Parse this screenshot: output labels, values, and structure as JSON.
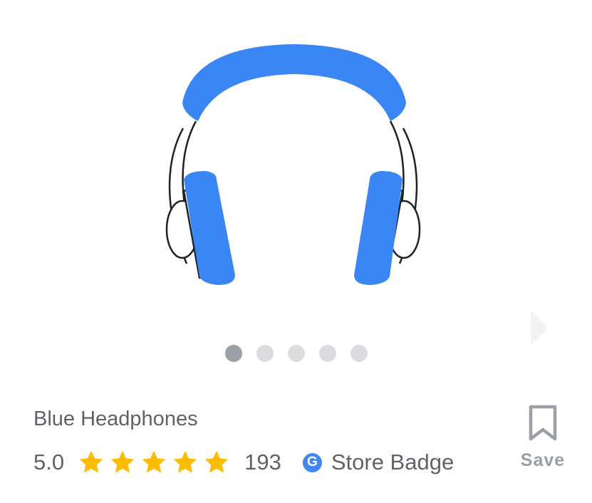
{
  "product": {
    "title": "Blue Headphones",
    "rating": "5.0",
    "star_count": 5,
    "reviews": "193",
    "store": {
      "icon": "google-g-icon",
      "label": "Store Badge",
      "logo_letter": "G"
    }
  },
  "carousel": {
    "total": 5,
    "active_index": 0,
    "next_icon": "chevron-right-icon"
  },
  "save": {
    "icon": "bookmark-icon",
    "label": "Save"
  },
  "colors": {
    "headphone_blue": "#3a86f5",
    "star": "#fbbc04",
    "text": "#5f6368",
    "dot_active": "#9aa0a6",
    "dot_inactive": "#dadce0",
    "google_blue": "#4285f4"
  }
}
